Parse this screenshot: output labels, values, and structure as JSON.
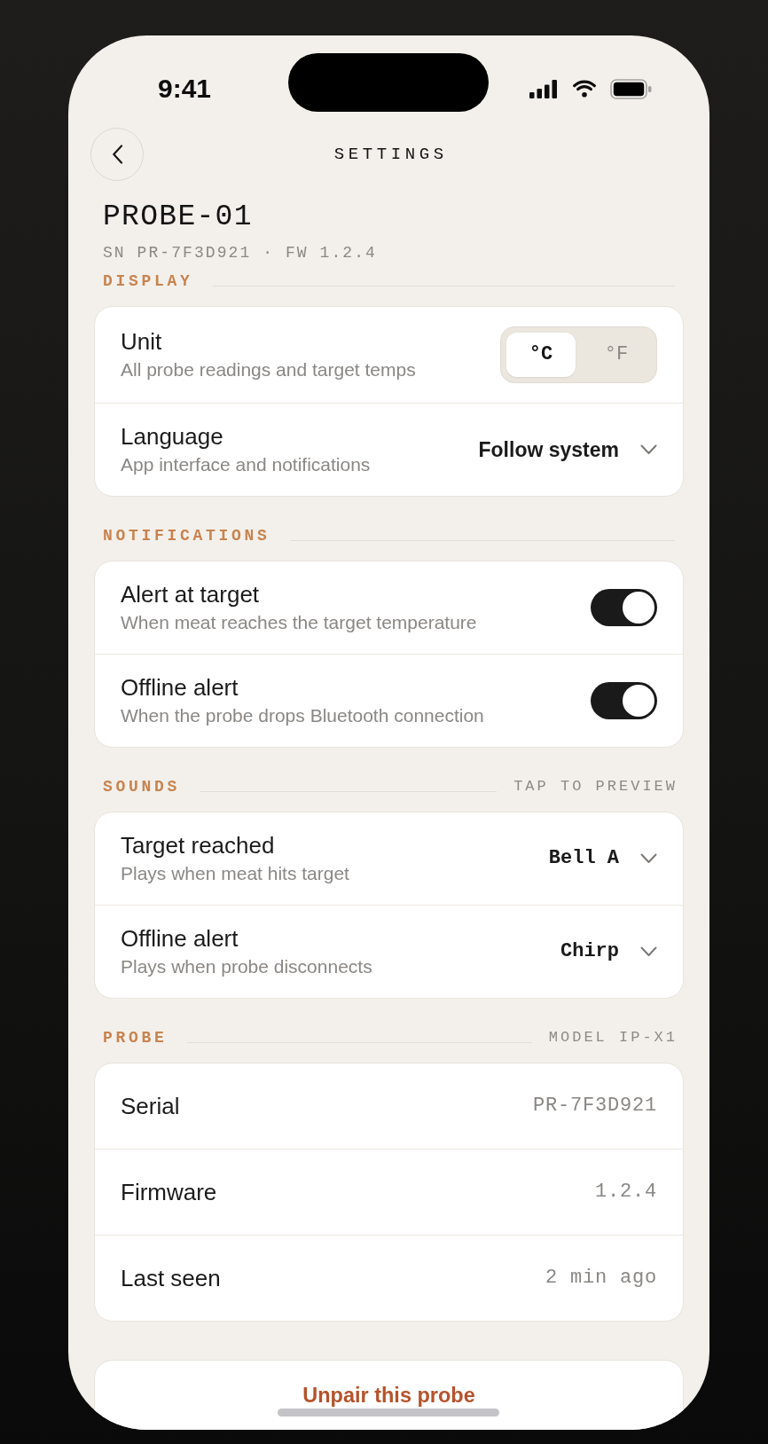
{
  "status_bar": {
    "time": "9:41"
  },
  "nav": {
    "title": "SETTINGS"
  },
  "device": {
    "name": "PROBE-01",
    "meta": "SN PR-7F3D921 · FW 1.2.4"
  },
  "sections": [
    {
      "title": "DISPLAY",
      "rows": [
        {
          "kind": "segmented",
          "label": "Unit",
          "description": "All probe readings and target temps",
          "options": [
            {
              "label": "°C",
              "selected": true
            },
            {
              "label": "°F",
              "selected": false
            }
          ]
        },
        {
          "kind": "dropdown",
          "label": "Language",
          "description": "App interface and notifications",
          "value": "Follow system"
        }
      ]
    },
    {
      "title": "NOTIFICATIONS",
      "rows": [
        {
          "kind": "toggle",
          "label": "Alert at target",
          "description": "When meat reaches the target temperature",
          "on": true
        },
        {
          "kind": "toggle",
          "label": "Offline alert",
          "description": "When the probe drops Bluetooth connection",
          "on": true
        }
      ]
    },
    {
      "title": "SOUNDS",
      "note": "TAP TO PREVIEW",
      "rows": [
        {
          "kind": "sound",
          "label": "Target reached",
          "description": "Plays when meat hits target",
          "value": "Bell A"
        },
        {
          "kind": "sound",
          "label": "Offline alert",
          "description": "Plays when probe disconnects",
          "value": "Chirp"
        }
      ]
    },
    {
      "title": "PROBE",
      "note": "MODEL IP-X1",
      "rows": [
        {
          "kind": "info",
          "label": "Serial",
          "value": "PR-7F3D921"
        },
        {
          "kind": "info",
          "label": "Firmware",
          "value": "1.2.4"
        },
        {
          "kind": "info",
          "label": "Last seen",
          "value": "2 min ago"
        }
      ]
    }
  ],
  "unpair_button": {
    "label": "Unpair this probe"
  }
}
